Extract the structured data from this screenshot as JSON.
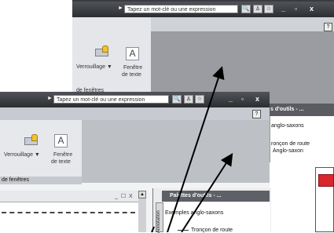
{
  "back_window": {
    "search_placeholder": "Tapez un mot-clé ou une expression",
    "help_label": "?",
    "ribbon": {
      "lock_label": "Verrouillage ▼",
      "window_text_line1": "Fenêtre",
      "window_text_line2": "de texte",
      "group_label": "de fenêtres"
    }
  },
  "back_palette": {
    "title": "s d'outils - ...",
    "item1": "anglo-saxons",
    "item2_line1": "ronçon de route",
    "item2_line2": "Anglo-saxon"
  },
  "front_window": {
    "search_placeholder": "Tapez un mot-clé ou une expression",
    "help_label": "?",
    "ribbon": {
      "lock_label": "Verrouillage ▼",
      "window_text_line1": "Fenêtre",
      "window_text_line2": "de texte",
      "group_label": "de fenêtres"
    },
    "drawing_controls": "_ ☐ X"
  },
  "front_palette": {
    "title": "Palettes d'outils - ...",
    "side_tab": "Annotation",
    "item1": "Exemples anglo-saxons",
    "item2": "Tronçon de route"
  },
  "icons": {
    "lock": "lock-icon",
    "text_window": "text-window-icon",
    "search": "search-icon",
    "star": "star-icon"
  },
  "colors": {
    "titlebar": "#2c2e32",
    "arrow": "#000000",
    "accent_red": "#d9272e"
  }
}
